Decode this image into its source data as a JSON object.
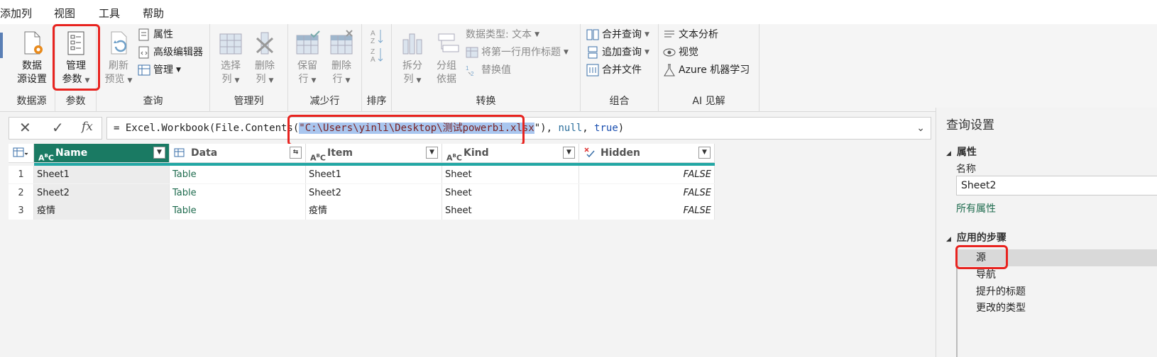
{
  "menu": [
    "添加列",
    "视图",
    "工具",
    "帮助"
  ],
  "ribbon": {
    "datasource": {
      "btn_line1": "数据",
      "btn_line2": "源设置",
      "label": "数据源"
    },
    "params": {
      "btn_line1": "管理",
      "btn_line2": "参数",
      "label": "参数"
    },
    "query": {
      "refresh_line1": "刷新",
      "refresh_line2": "预览",
      "properties": "属性",
      "advanced": "高级编辑器",
      "manage": "管理",
      "label": "查询"
    },
    "columns": {
      "choose_line1": "选择",
      "choose_line2": "列",
      "remove_line1": "删除",
      "remove_line2": "列",
      "label": "管理列"
    },
    "rows": {
      "keep_line1": "保留",
      "keep_line2": "行",
      "remove_line1": "删除",
      "remove_line2": "行",
      "label": "减少行"
    },
    "sort": {
      "label": "排序"
    },
    "transform": {
      "split_line1": "拆分",
      "split_line2": "列",
      "group_line1": "分组",
      "group_line2": "依据",
      "datatype": "数据类型: 文本",
      "firstrow": "将第一行用作标题",
      "replace": "替换值",
      "label": "转换"
    },
    "combine": {
      "merge": "合并查询",
      "append": "追加查询",
      "files": "合并文件",
      "label": "组合"
    },
    "ai": {
      "text": "文本分析",
      "vision": "视觉",
      "azure": "Azure 机器学习",
      "label": "AI 见解"
    }
  },
  "formula": {
    "prefix": "= Excel.Workbook(File.Contents(",
    "quote_open": "\"",
    "path": "C:\\Users\\yinli\\Desktop\\测试powerbi.xlsx",
    "quote_close": "\")",
    "sep1": ", ",
    "null": "null",
    "sep2": ", ",
    "true": "true",
    "close": ")"
  },
  "table": {
    "columns": [
      {
        "type": "ABC",
        "name": "Name"
      },
      {
        "type": "TBL",
        "name": "Data"
      },
      {
        "type": "ABC",
        "name": "Item"
      },
      {
        "type": "ABC",
        "name": "Kind"
      },
      {
        "type": "BOOL",
        "name": "Hidden"
      }
    ],
    "rows": [
      {
        "n": "1",
        "name": "Sheet1",
        "data": "Table",
        "item": "Sheet1",
        "kind": "Sheet",
        "hidden": "FALSE"
      },
      {
        "n": "2",
        "name": "Sheet2",
        "data": "Table",
        "item": "Sheet2",
        "kind": "Sheet",
        "hidden": "FALSE"
      },
      {
        "n": "3",
        "name": "疫情",
        "data": "Table",
        "item": "疫情",
        "kind": "Sheet",
        "hidden": "FALSE"
      }
    ]
  },
  "pane": {
    "title": "查询设置",
    "props_header": "属性",
    "name_label": "名称",
    "name_value": "Sheet2",
    "all_props": "所有属性",
    "steps_header": "应用的步骤",
    "steps": [
      "源",
      "导航",
      "提升的标题",
      "更改的类型"
    ]
  },
  "colors": {
    "accent": "#1a7a63",
    "highlight": "#e8231f",
    "teal": "#22a7a4"
  }
}
